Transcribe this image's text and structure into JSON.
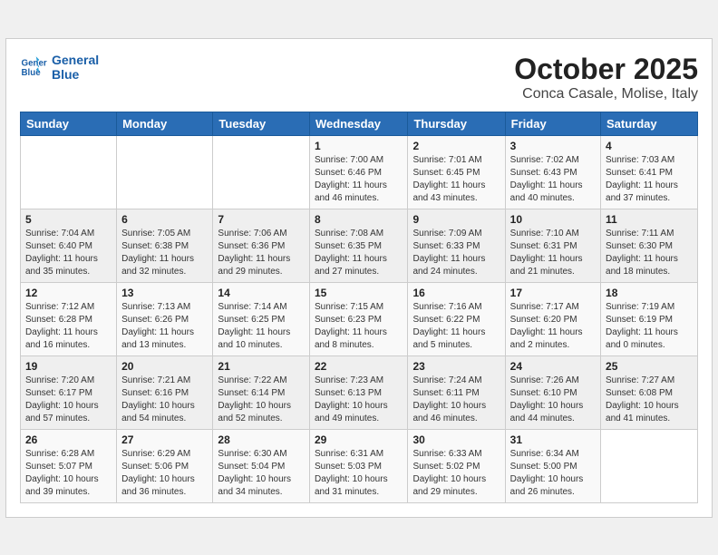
{
  "header": {
    "logo_line1": "General",
    "logo_line2": "Blue",
    "month_title": "October 2025",
    "location": "Conca Casale, Molise, Italy"
  },
  "weekdays": [
    "Sunday",
    "Monday",
    "Tuesday",
    "Wednesday",
    "Thursday",
    "Friday",
    "Saturday"
  ],
  "rows": [
    [
      {
        "day": "",
        "content": ""
      },
      {
        "day": "",
        "content": ""
      },
      {
        "day": "",
        "content": ""
      },
      {
        "day": "1",
        "content": "Sunrise: 7:00 AM\nSunset: 6:46 PM\nDaylight: 11 hours\nand 46 minutes."
      },
      {
        "day": "2",
        "content": "Sunrise: 7:01 AM\nSunset: 6:45 PM\nDaylight: 11 hours\nand 43 minutes."
      },
      {
        "day": "3",
        "content": "Sunrise: 7:02 AM\nSunset: 6:43 PM\nDaylight: 11 hours\nand 40 minutes."
      },
      {
        "day": "4",
        "content": "Sunrise: 7:03 AM\nSunset: 6:41 PM\nDaylight: 11 hours\nand 37 minutes."
      }
    ],
    [
      {
        "day": "5",
        "content": "Sunrise: 7:04 AM\nSunset: 6:40 PM\nDaylight: 11 hours\nand 35 minutes."
      },
      {
        "day": "6",
        "content": "Sunrise: 7:05 AM\nSunset: 6:38 PM\nDaylight: 11 hours\nand 32 minutes."
      },
      {
        "day": "7",
        "content": "Sunrise: 7:06 AM\nSunset: 6:36 PM\nDaylight: 11 hours\nand 29 minutes."
      },
      {
        "day": "8",
        "content": "Sunrise: 7:08 AM\nSunset: 6:35 PM\nDaylight: 11 hours\nand 27 minutes."
      },
      {
        "day": "9",
        "content": "Sunrise: 7:09 AM\nSunset: 6:33 PM\nDaylight: 11 hours\nand 24 minutes."
      },
      {
        "day": "10",
        "content": "Sunrise: 7:10 AM\nSunset: 6:31 PM\nDaylight: 11 hours\nand 21 minutes."
      },
      {
        "day": "11",
        "content": "Sunrise: 7:11 AM\nSunset: 6:30 PM\nDaylight: 11 hours\nand 18 minutes."
      }
    ],
    [
      {
        "day": "12",
        "content": "Sunrise: 7:12 AM\nSunset: 6:28 PM\nDaylight: 11 hours\nand 16 minutes."
      },
      {
        "day": "13",
        "content": "Sunrise: 7:13 AM\nSunset: 6:26 PM\nDaylight: 11 hours\nand 13 minutes."
      },
      {
        "day": "14",
        "content": "Sunrise: 7:14 AM\nSunset: 6:25 PM\nDaylight: 11 hours\nand 10 minutes."
      },
      {
        "day": "15",
        "content": "Sunrise: 7:15 AM\nSunset: 6:23 PM\nDaylight: 11 hours\nand 8 minutes."
      },
      {
        "day": "16",
        "content": "Sunrise: 7:16 AM\nSunset: 6:22 PM\nDaylight: 11 hours\nand 5 minutes."
      },
      {
        "day": "17",
        "content": "Sunrise: 7:17 AM\nSunset: 6:20 PM\nDaylight: 11 hours\nand 2 minutes."
      },
      {
        "day": "18",
        "content": "Sunrise: 7:19 AM\nSunset: 6:19 PM\nDaylight: 11 hours\nand 0 minutes."
      }
    ],
    [
      {
        "day": "19",
        "content": "Sunrise: 7:20 AM\nSunset: 6:17 PM\nDaylight: 10 hours\nand 57 minutes."
      },
      {
        "day": "20",
        "content": "Sunrise: 7:21 AM\nSunset: 6:16 PM\nDaylight: 10 hours\nand 54 minutes."
      },
      {
        "day": "21",
        "content": "Sunrise: 7:22 AM\nSunset: 6:14 PM\nDaylight: 10 hours\nand 52 minutes."
      },
      {
        "day": "22",
        "content": "Sunrise: 7:23 AM\nSunset: 6:13 PM\nDaylight: 10 hours\nand 49 minutes."
      },
      {
        "day": "23",
        "content": "Sunrise: 7:24 AM\nSunset: 6:11 PM\nDaylight: 10 hours\nand 46 minutes."
      },
      {
        "day": "24",
        "content": "Sunrise: 7:26 AM\nSunset: 6:10 PM\nDaylight: 10 hours\nand 44 minutes."
      },
      {
        "day": "25",
        "content": "Sunrise: 7:27 AM\nSunset: 6:08 PM\nDaylight: 10 hours\nand 41 minutes."
      }
    ],
    [
      {
        "day": "26",
        "content": "Sunrise: 6:28 AM\nSunset: 5:07 PM\nDaylight: 10 hours\nand 39 minutes."
      },
      {
        "day": "27",
        "content": "Sunrise: 6:29 AM\nSunset: 5:06 PM\nDaylight: 10 hours\nand 36 minutes."
      },
      {
        "day": "28",
        "content": "Sunrise: 6:30 AM\nSunset: 5:04 PM\nDaylight: 10 hours\nand 34 minutes."
      },
      {
        "day": "29",
        "content": "Sunrise: 6:31 AM\nSunset: 5:03 PM\nDaylight: 10 hours\nand 31 minutes."
      },
      {
        "day": "30",
        "content": "Sunrise: 6:33 AM\nSunset: 5:02 PM\nDaylight: 10 hours\nand 29 minutes."
      },
      {
        "day": "31",
        "content": "Sunrise: 6:34 AM\nSunset: 5:00 PM\nDaylight: 10 hours\nand 26 minutes."
      },
      {
        "day": "",
        "content": ""
      }
    ]
  ]
}
